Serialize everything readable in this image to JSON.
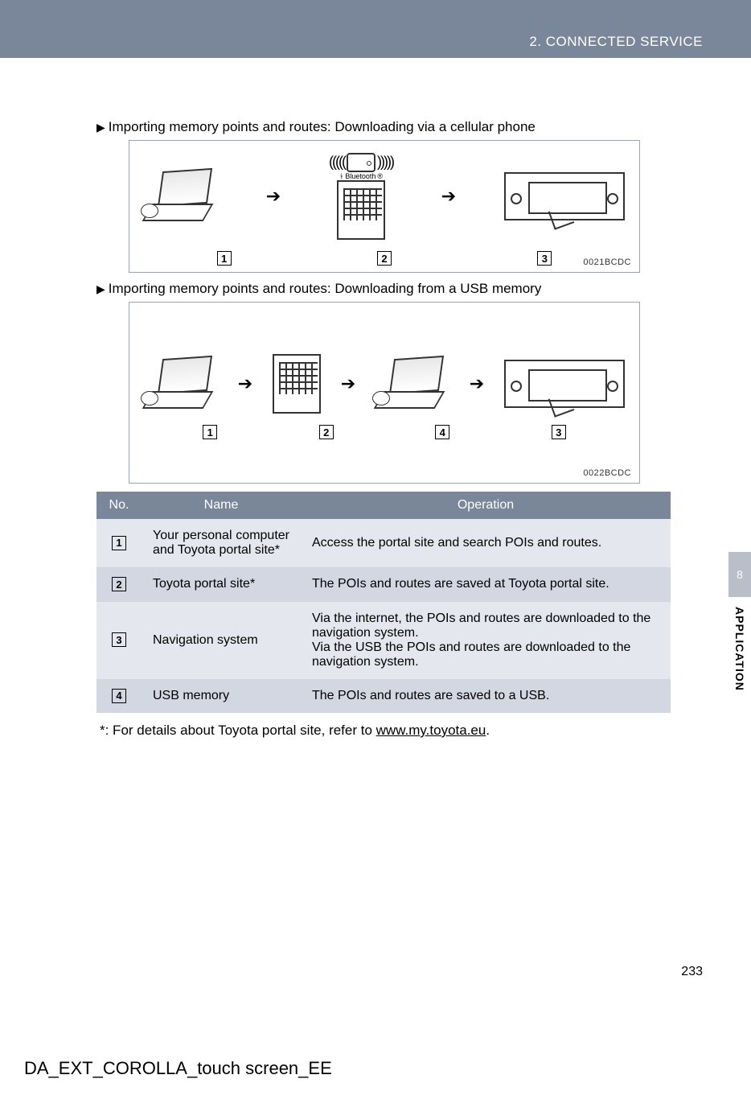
{
  "header": {
    "breadcrumb": "2. CONNECTED SERVICE"
  },
  "sections": {
    "cellular_title": "Importing memory points and routes: Downloading via a cellular phone",
    "usb_title": "Importing memory points and routes: Downloading from a USB memory"
  },
  "diagram_codes": {
    "cellular": "0021BCDC",
    "usb": "0022BCDC"
  },
  "bluetooth_label": "Bluetooth",
  "num_labels": {
    "n1": "1",
    "n2": "2",
    "n3": "3",
    "n4": "4"
  },
  "table": {
    "headers": {
      "no": "No.",
      "name": "Name",
      "operation": "Operation"
    },
    "rows": [
      {
        "num": "1",
        "name": "Your personal computer and Toyota portal site*",
        "operation": "Access the portal site and search POIs and routes."
      },
      {
        "num": "2",
        "name": "Toyota portal site*",
        "operation": "The POIs and routes are saved at Toyota portal site."
      },
      {
        "num": "3",
        "name": "Navigation system",
        "operation": "Via the internet, the POIs and routes are downloaded to the navigation system.\nVia the USB the POIs and routes are downloaded to the navigation system."
      },
      {
        "num": "4",
        "name": "USB memory",
        "operation": "The POIs and routes are saved to a USB."
      }
    ]
  },
  "footnote": {
    "prefix": "*: For details about Toyota portal site, refer to ",
    "link": "www.my.toyota.eu",
    "suffix": "."
  },
  "side_tab": {
    "number": "8",
    "label": "APPLICATION"
  },
  "page_number": "233",
  "footer_code": "DA_EXT_COROLLA_touch screen_EE",
  "chart_data": {
    "type": "table",
    "title": "Connected Service – Importing memory points and routes: component roles",
    "columns": [
      "No.",
      "Name",
      "Operation"
    ],
    "rows": [
      [
        "1",
        "Your personal computer and Toyota portal site*",
        "Access the portal site and search POIs and routes."
      ],
      [
        "2",
        "Toyota portal site*",
        "The POIs and routes are saved at Toyota portal site."
      ],
      [
        "3",
        "Navigation system",
        "Via the internet, the POIs and routes are downloaded to the navigation system. Via the USB the POIs and routes are downloaded to the navigation system."
      ],
      [
        "4",
        "USB memory",
        "The POIs and routes are saved to a USB."
      ]
    ]
  }
}
